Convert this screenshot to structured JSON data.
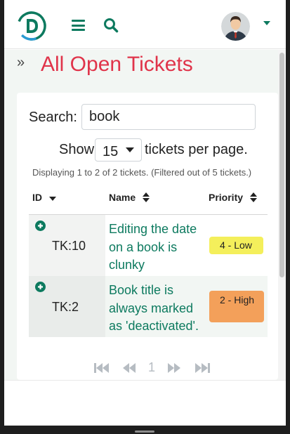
{
  "header": {
    "logo_icon": "d-logo-icon",
    "menu_icon": "hamburger-menu-icon",
    "search_icon": "search-icon",
    "avatar_icon": "user-avatar-icon",
    "user_menu_icon": "caret-down-icon",
    "brand_color": "#0d7a5f"
  },
  "page": {
    "sidebar_toggle": "»",
    "title": "All Open Tickets",
    "title_color": "#e0344a"
  },
  "filter": {
    "search_label": "Search:",
    "search_value": "book",
    "show_label": "Show",
    "per_page_value": "15",
    "per_page_suffix": "tickets per page.",
    "info": "Displaying 1 to 2 of 2 tickets. (Filtered out of 5 tickets.)"
  },
  "table": {
    "columns": [
      {
        "label": "ID",
        "sort": "desc"
      },
      {
        "label": "Name",
        "sort": "none"
      },
      {
        "label": "Priority",
        "sort": "none"
      }
    ],
    "rows": [
      {
        "id": "TK:10",
        "name": "Editing the date on a book is clunky",
        "priority": "4 - Low",
        "priority_color": "#f4ef5b"
      },
      {
        "id": "TK:2",
        "name": "Book title is always marked as 'deactivated'.",
        "priority": "2 - High",
        "priority_color": "#f3a05a"
      }
    ]
  },
  "pagination": {
    "first_icon": "first-page-icon",
    "prev_icon": "previous-page-icon",
    "current_page": "1",
    "next_icon": "next-page-icon",
    "last_icon": "last-page-icon"
  }
}
